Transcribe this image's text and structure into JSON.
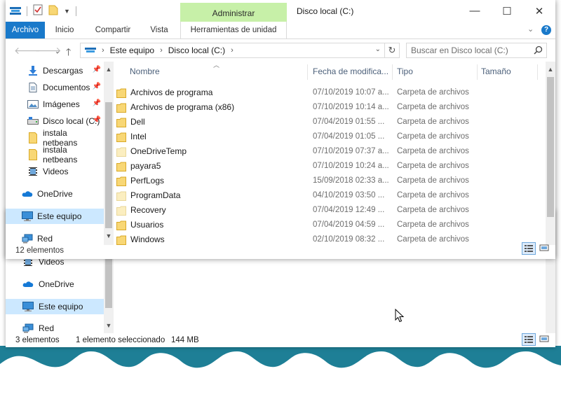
{
  "window": {
    "title": "Disco local (C:)",
    "context_tab_group": "Administrar",
    "controls": {
      "minimize": "—",
      "maximize": "☐",
      "close": "✕"
    }
  },
  "ribbon": {
    "tabs": [
      "Archivo",
      "Inicio",
      "Compartir",
      "Vista",
      "Herramientas de unidad"
    ],
    "help": "?"
  },
  "address": {
    "crumbs": [
      "Este equipo",
      "Disco local (C:)"
    ]
  },
  "search": {
    "placeholder": "Buscar en Disco local (C:)"
  },
  "nav_pane": {
    "items": [
      {
        "label": "Descargas",
        "icon": "download-icon",
        "pinned": true
      },
      {
        "label": "Documentos",
        "icon": "document-icon",
        "pinned": true
      },
      {
        "label": "Imágenes",
        "icon": "pictures-icon",
        "pinned": true
      },
      {
        "label": "Disco local (C:)",
        "icon": "drive-icon",
        "pinned": true
      },
      {
        "label": "instala netbeans",
        "icon": "folder-icon",
        "pinned": false
      },
      {
        "label": "instala netbeans",
        "icon": "folder-icon",
        "pinned": false
      },
      {
        "label": "Videos",
        "icon": "videos-icon",
        "pinned": false
      },
      {
        "label": "OneDrive",
        "icon": "onedrive-icon",
        "pinned": false
      },
      {
        "label": "Este equipo",
        "icon": "computer-icon",
        "pinned": false,
        "selected": true
      },
      {
        "label": "Red",
        "icon": "network-icon",
        "pinned": false
      }
    ]
  },
  "columns": {
    "name": "Nombre",
    "date": "Fecha de modifica...",
    "type": "Tipo",
    "size": "Tamaño"
  },
  "files": [
    {
      "name": "Archivos de programa",
      "date": "07/10/2019 10:07 a...",
      "type": "Carpeta de archivos",
      "pale": false
    },
    {
      "name": "Archivos de programa (x86)",
      "date": "07/10/2019 10:14 a...",
      "type": "Carpeta de archivos",
      "pale": false
    },
    {
      "name": "Dell",
      "date": "07/04/2019 01:55 ...",
      "type": "Carpeta de archivos",
      "pale": false
    },
    {
      "name": "Intel",
      "date": "07/04/2019 01:05 ...",
      "type": "Carpeta de archivos",
      "pale": false
    },
    {
      "name": "OneDriveTemp",
      "date": "07/10/2019 07:37 a...",
      "type": "Carpeta de archivos",
      "pale": true
    },
    {
      "name": "payara5",
      "date": "07/10/2019 10:24 a...",
      "type": "Carpeta de archivos",
      "pale": false
    },
    {
      "name": "PerfLogs",
      "date": "15/09/2018 02:33 a...",
      "type": "Carpeta de archivos",
      "pale": false
    },
    {
      "name": "ProgramData",
      "date": "04/10/2019 03:50 ...",
      "type": "Carpeta de archivos",
      "pale": true
    },
    {
      "name": "Recovery",
      "date": "07/04/2019 12:49 ...",
      "type": "Carpeta de archivos",
      "pale": true
    },
    {
      "name": "Usuarios",
      "date": "07/04/2019 04:59 ...",
      "type": "Carpeta de archivos",
      "pale": false
    },
    {
      "name": "Windows",
      "date": "02/10/2019 08:32 ...",
      "type": "Carpeta de archivos",
      "pale": false
    }
  ],
  "status": {
    "count": "12 elementos"
  },
  "bg_window": {
    "nav_items": [
      {
        "label": "Videos",
        "icon": "videos-icon"
      },
      {
        "label": "OneDrive",
        "icon": "onedrive-icon"
      },
      {
        "label": "Este equipo",
        "icon": "computer-icon",
        "selected": true
      },
      {
        "label": "Red",
        "icon": "network-icon"
      }
    ],
    "status_count": "3 elementos",
    "status_selection": "1 elemento seleccionado",
    "status_size": "144 MB"
  },
  "colors": {
    "accent": "#1979ca",
    "context_tab": "#c7f0a8",
    "selection": "#cce8ff",
    "folder": "#f8d775",
    "desktop_teal": "#1e7f96"
  }
}
